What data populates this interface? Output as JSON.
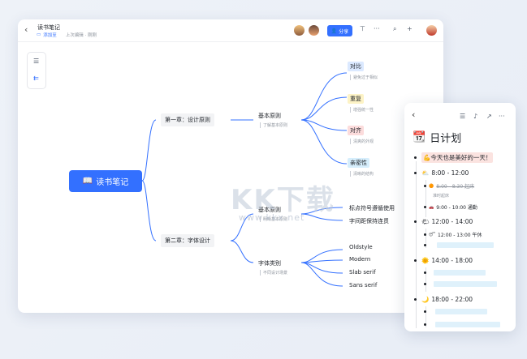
{
  "header": {
    "back_icon": "chevron-left-icon",
    "title": "读书笔记",
    "folder": "添加至",
    "saved": "上次编辑 · 刚刚",
    "share_label": "分享",
    "icons": [
      "present-icon",
      "more-icon",
      "search-icon",
      "plus-icon"
    ]
  },
  "toolbar": {
    "icons": [
      "outline-icon",
      "collapse-icon"
    ]
  },
  "mindmap": {
    "root": "读书笔记",
    "root_icon": "📖",
    "chapters": [
      {
        "label": "第一章：设计原则",
        "branch": "基本原则",
        "branch_note": "了解基本原则",
        "items": [
          {
            "label": "对比",
            "note": "避免过于相似",
            "color": "#dbe9ff"
          },
          {
            "label": "重复",
            "note": "增强统一性",
            "color": "#fdf3c6"
          },
          {
            "label": "对齐",
            "note": "清爽的外观",
            "color": "#fcdcdc"
          },
          {
            "label": "亲密性",
            "note": "清晰的结构",
            "color": "#d6eefc"
          }
        ]
      },
      {
        "label": "第二章：字体设计",
        "branches": [
          {
            "label": "基本原则",
            "note": "明晰基本原则",
            "items": [
              "标点符号遵循使用",
              "字间距保持连贯"
            ]
          },
          {
            "label": "字体类别",
            "note": "不同设计场景",
            "items": [
              "Oldstyle",
              "Modern",
              "Slab serif",
              "Sans serif"
            ]
          }
        ]
      }
    ]
  },
  "watermark": {
    "main": "KK下载",
    "url": "www.kkx.net"
  },
  "planner": {
    "back_icon": "chevron-left-icon",
    "icons": [
      "outline-icon",
      "bell-icon",
      "share-icon",
      "more-icon"
    ],
    "title_icon": "📆",
    "title": "日计划",
    "motto_icon": "💪",
    "motto": "今天也是美好的一天！",
    "blocks": [
      {
        "icon": "⛅",
        "time": "8:00 - 12:00",
        "entries": [
          {
            "icon": "🟠",
            "text": "8:00 - 8:30 起床",
            "done": true,
            "note": "准时起床"
          },
          {
            "icon": "🚗",
            "text": "9:00 - 10:00 通勤",
            "done": false
          }
        ]
      },
      {
        "icon": "🌤",
        "time": "12:00 - 14:00",
        "entries": [
          {
            "icon": "😴",
            "text": "12:00 - 13:00 午休",
            "done": false
          }
        ]
      },
      {
        "icon": "🌞",
        "time": "14:00 - 18:00",
        "entries": []
      },
      {
        "icon": "🌙",
        "time": "18:00 - 22:00",
        "entries": []
      }
    ]
  }
}
